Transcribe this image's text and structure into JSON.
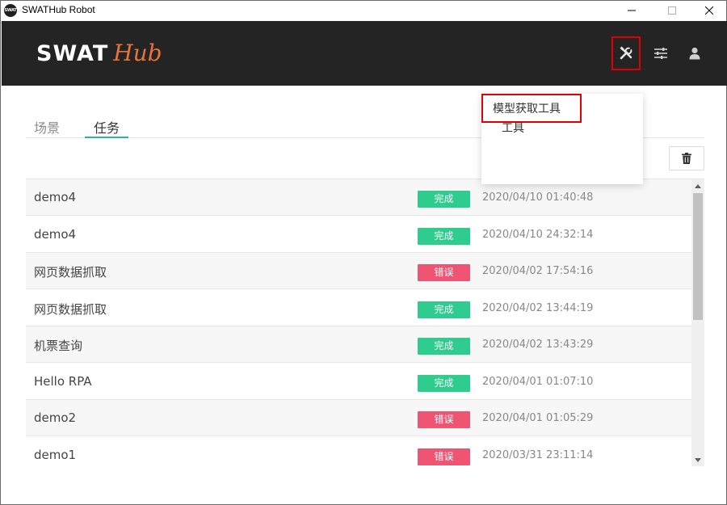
{
  "window": {
    "title": "SWATHub Robot",
    "app_icon_text": "SWAT"
  },
  "header": {
    "logo_primary": "SWAT",
    "logo_secondary": "Hub",
    "logo_primary_color": "#ffffff",
    "logo_secondary_color": "#e8733a",
    "background_color": "#242424",
    "buttons": [
      {
        "icon": "tools-icon",
        "highlighted": true
      },
      {
        "icon": "sliders-icon",
        "highlighted": false
      },
      {
        "icon": "user-icon",
        "highlighted": false
      }
    ]
  },
  "tabs": [
    {
      "label": "场景",
      "active": false
    },
    {
      "label": "任务",
      "active": true
    }
  ],
  "dropdown": {
    "items": [
      {
        "label": "工具"
      },
      {
        "label": "模型获取工具",
        "highlighted": true
      }
    ]
  },
  "toolbar": {
    "delete_icon": "trash-icon"
  },
  "status_colors": {
    "完成": "#2ecc8f",
    "错误": "#ef5473"
  },
  "tasks": [
    {
      "name": "demo4",
      "status": "完成",
      "time": "2020/04/10 01:40:48"
    },
    {
      "name": "demo4",
      "status": "完成",
      "time": "2020/04/10 24:32:14"
    },
    {
      "name": "网页数据抓取",
      "status": "错误",
      "time": "2020/04/02 17:54:16"
    },
    {
      "name": "网页数据抓取",
      "status": "完成",
      "time": "2020/04/02 13:44:19"
    },
    {
      "name": "机票查询",
      "status": "完成",
      "time": "2020/04/02 13:43:29"
    },
    {
      "name": "Hello RPA",
      "status": "完成",
      "time": "2020/04/01 01:07:10"
    },
    {
      "name": "demo2",
      "status": "错误",
      "time": "2020/04/01 01:05:29"
    },
    {
      "name": "demo1",
      "status": "错误",
      "time": "2020/03/31 23:11:14"
    }
  ]
}
